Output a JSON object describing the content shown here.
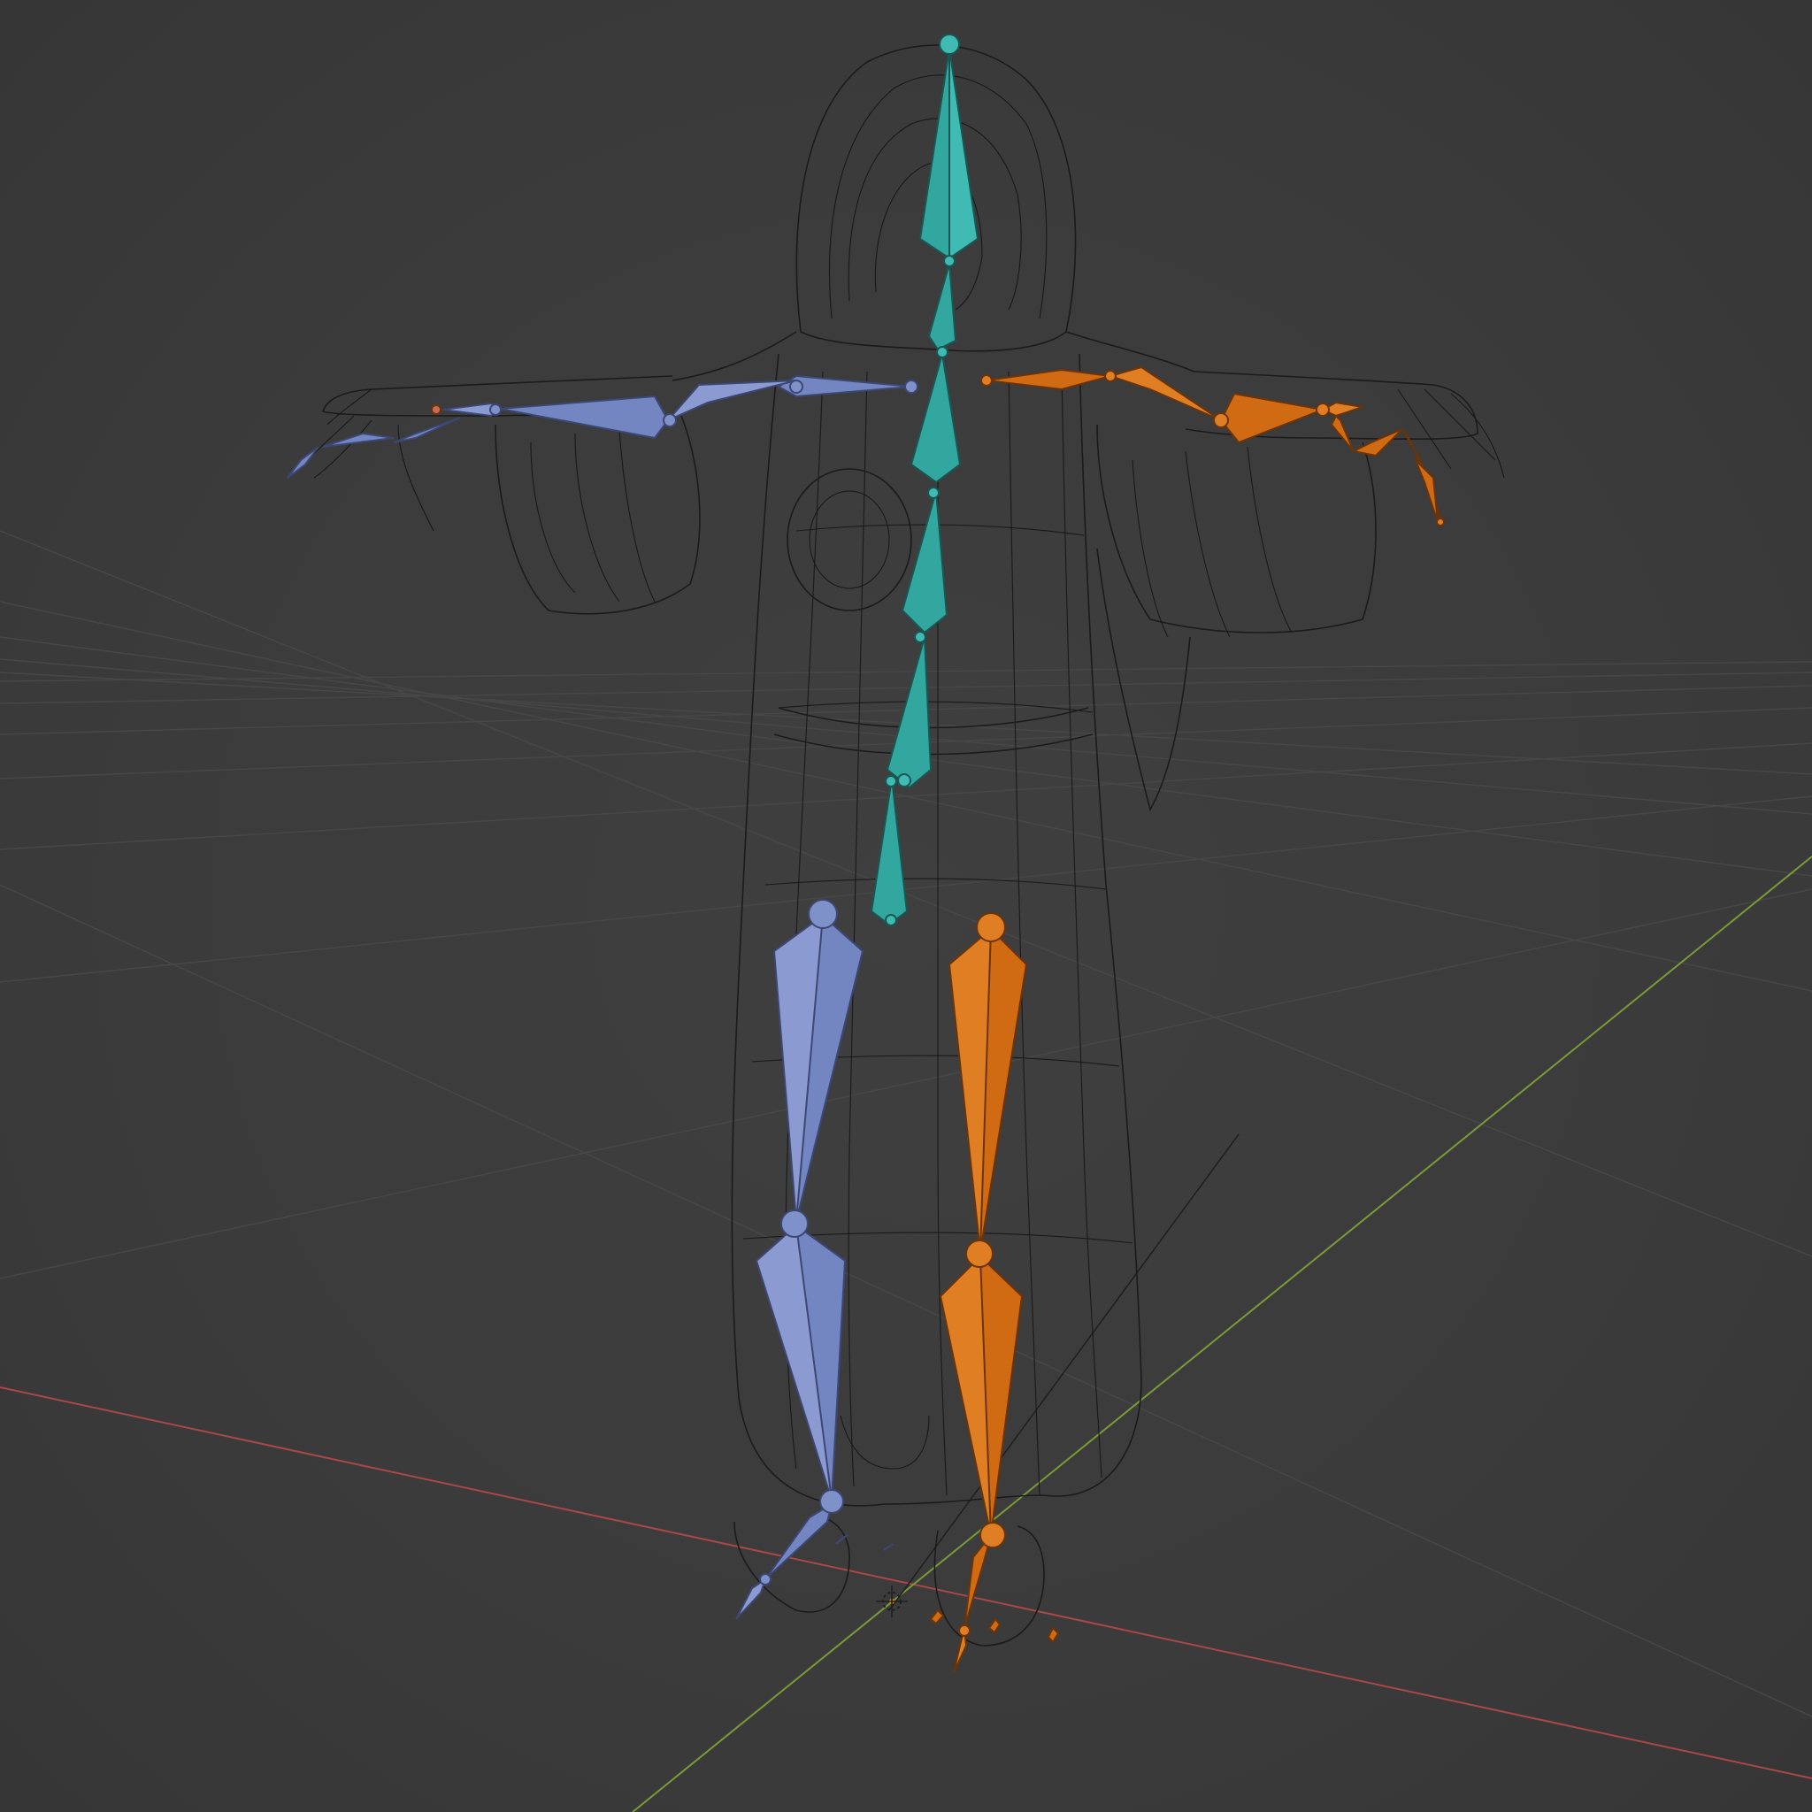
{
  "viewport": {
    "background_color": "#3d3d3d",
    "grid_color": "#4a4a4a",
    "x_axis_color": "#b04a4a",
    "y_axis_color": "#7c9a3a",
    "wireframe_color": "#1b1b1b",
    "bone_colors": {
      "left_side": "#7486c2",
      "right_side": "#d06b14",
      "center": "#32a7a0"
    }
  }
}
